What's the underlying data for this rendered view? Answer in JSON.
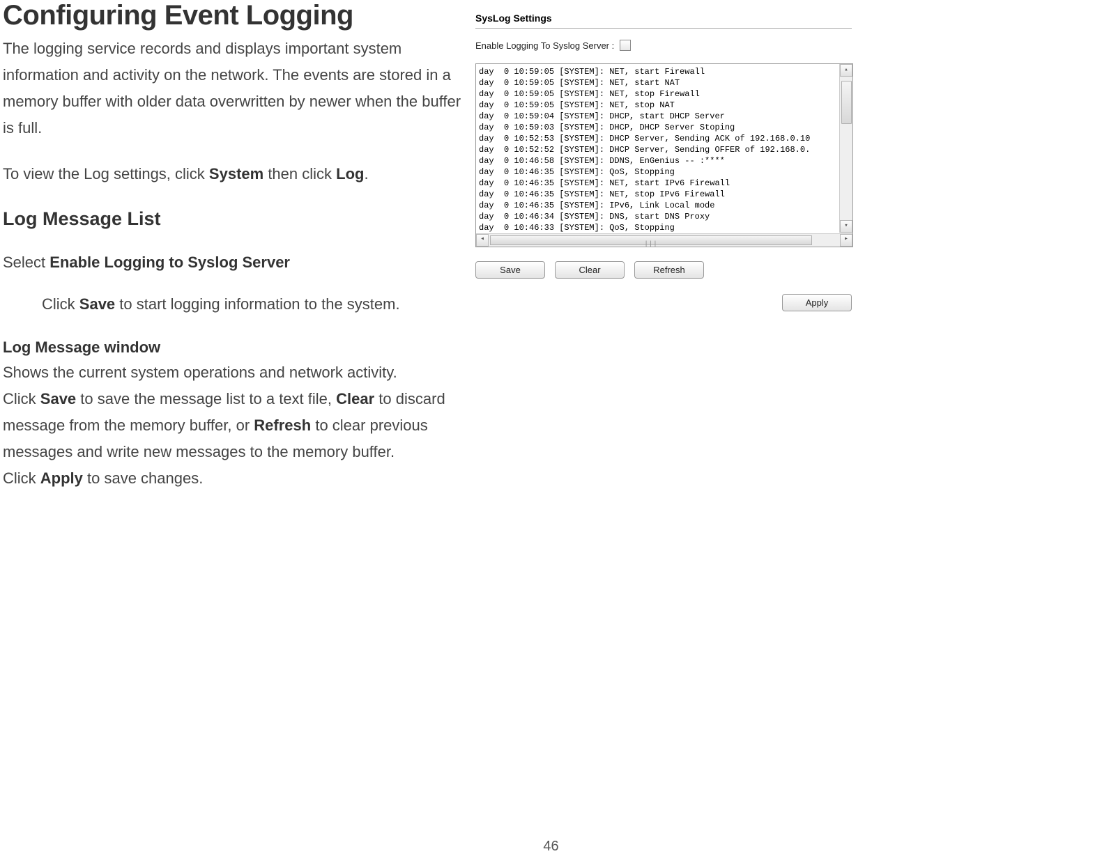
{
  "doc": {
    "title": "Configuring Event Logging",
    "intro": "The logging service records and displays important system information and activity on the network. The events are stored in a memory buffer with older data overwritten by newer when the buffer is full.",
    "view_instr_pre": "To view the Log settings, click ",
    "view_instr_system": "System",
    "view_instr_mid": " then click ",
    "view_instr_log": "Log",
    "view_instr_post": ".",
    "h2": "Log Message List",
    "sel_pre": "Select ",
    "sel_bold": "Enable Logging to Syslog Server",
    "sel_indent_pre": "Click ",
    "sel_indent_save": "Save",
    "sel_indent_post": " to start logging information to the system.",
    "h3": "Log Message window",
    "win_p1": "Shows the current system operations and network activity.",
    "win_p2_pre": "Click ",
    "win_p2_save": "Save",
    "win_p2_mid1": " to save the message list to a text file, ",
    "win_p2_clear": "Clear",
    "win_p2_mid2": " to discard message from the memory buffer, or ",
    "win_p2_refresh": "Refresh",
    "win_p2_mid3": " to clear previous messages and write new messages to the memory buffer.",
    "win_p3_pre": "Click ",
    "win_p3_apply": "Apply",
    "win_p3_post": " to save changes.",
    "page_num": "46"
  },
  "panel": {
    "section_title": "SysLog Settings",
    "enable_label": "Enable Logging To Syslog Server :",
    "log_lines": [
      "day  0 10:59:05 [SYSTEM]: NET, start Firewall",
      "day  0 10:59:05 [SYSTEM]: NET, start NAT",
      "day  0 10:59:05 [SYSTEM]: NET, stop Firewall",
      "day  0 10:59:05 [SYSTEM]: NET, stop NAT",
      "day  0 10:59:04 [SYSTEM]: DHCP, start DHCP Server",
      "day  0 10:59:03 [SYSTEM]: DHCP, DHCP Server Stoping",
      "day  0 10:52:53 [SYSTEM]: DHCP Server, Sending ACK of 192.168.0.10",
      "day  0 10:52:52 [SYSTEM]: DHCP Server, Sending OFFER of 192.168.0.",
      "day  0 10:46:58 [SYSTEM]: DDNS, EnGenius -- :****",
      "day  0 10:46:35 [SYSTEM]: QoS, Stopping",
      "day  0 10:46:35 [SYSTEM]: NET, start IPv6 Firewall",
      "day  0 10:46:35 [SYSTEM]: NET, stop IPv6 Firewall",
      "day  0 10:46:35 [SYSTEM]: IPv6, Link Local mode",
      "day  0 10:46:34 [SYSTEM]: DNS, start DNS Proxy",
      "day  0 10:46:33 [SYSTEM]: QoS, Stopping"
    ],
    "buttons": {
      "save": "Save",
      "clear": "Clear",
      "refresh": "Refresh",
      "apply": "Apply"
    },
    "scroll": {
      "up": "▴",
      "down": "▾",
      "left": "◂",
      "right": "▸",
      "mid": "|||"
    }
  }
}
